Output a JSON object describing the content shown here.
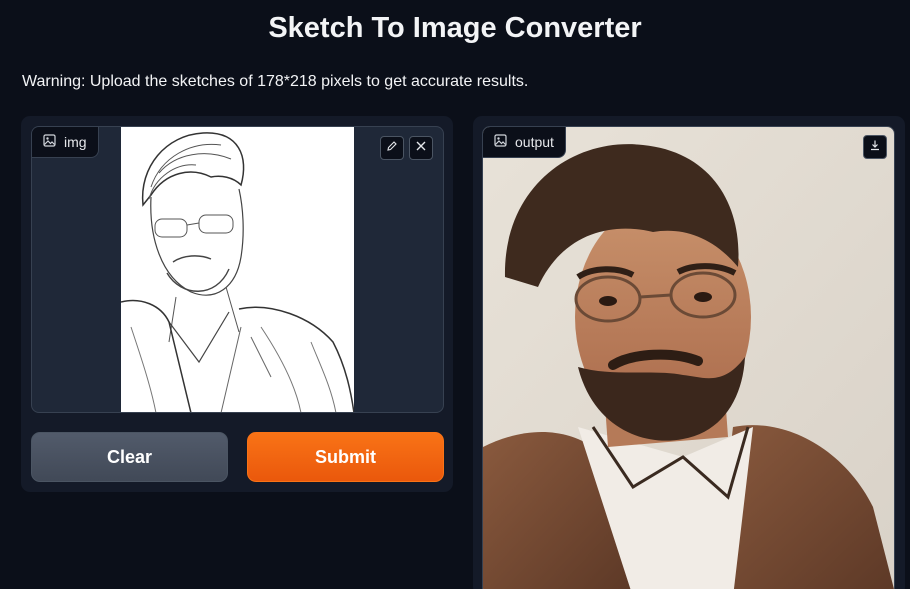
{
  "app": {
    "title": "Sketch To Image Converter",
    "warning": "Warning: Upload the sketches of 178*218 pixels to get accurate results."
  },
  "input": {
    "label": "img",
    "label_icon": "image-icon",
    "edit_icon": "pencil-icon",
    "clear_icon": "close-icon"
  },
  "buttons": {
    "clear_label": "Clear",
    "submit_label": "Submit"
  },
  "output": {
    "label": "output",
    "label_icon": "image-icon",
    "download_icon": "download-icon"
  },
  "colors": {
    "background": "#0b0f19",
    "panel": "#141a28",
    "submit": "#f97316",
    "clear": "#4b5563"
  }
}
